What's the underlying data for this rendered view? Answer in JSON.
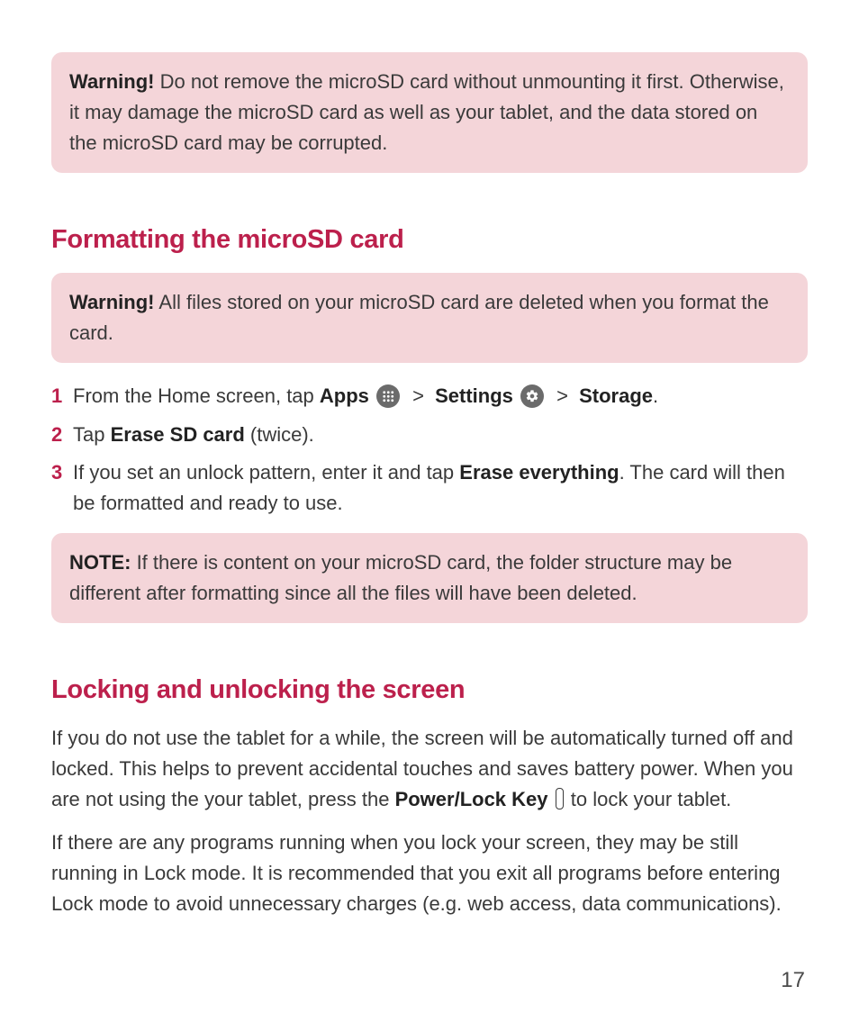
{
  "warning1": {
    "label": "Warning!",
    "text": " Do not remove the microSD card without unmounting it first. Otherwise, it may damage the microSD card as well as your tablet, and the data stored on the microSD card may be corrupted."
  },
  "section1": {
    "heading": "Formatting the microSD card",
    "warning": {
      "label": "Warning!",
      "text": " All files stored on your microSD card are deleted when you format the card."
    },
    "steps": {
      "s1": {
        "num": "1",
        "pre": "From the Home screen, tap ",
        "apps": "Apps",
        "sep1": " > ",
        "settings": "Settings",
        "sep2": " > ",
        "storage": "Storage",
        "post": "."
      },
      "s2": {
        "num": "2",
        "pre": "Tap ",
        "erase": "Erase SD card",
        "post": " (twice)."
      },
      "s3": {
        "num": "3",
        "pre": "If you set an unlock pattern, enter it and tap ",
        "erase_all": "Erase everything",
        "post": ". The card will then be formatted and ready to use."
      }
    },
    "note": {
      "label": "NOTE:",
      "text": " If there is content on your microSD card, the folder structure may be different after formatting since all the files will have been deleted."
    }
  },
  "section2": {
    "heading": "Locking and unlocking the screen",
    "p1a": "If you do not use the tablet for a while, the screen will be automatically turned off and locked. This helps to prevent accidental touches and saves battery power. When you are not using the your tablet, press the ",
    "p1b": "Power/Lock Key",
    "p1c": " to lock your tablet.",
    "p2": "If there are any programs running when you lock your screen, they may be still running in Lock mode. It is recommended that you exit all programs before entering Lock mode to avoid unnecessary charges (e.g. web access, data communications)."
  },
  "page_number": "17"
}
